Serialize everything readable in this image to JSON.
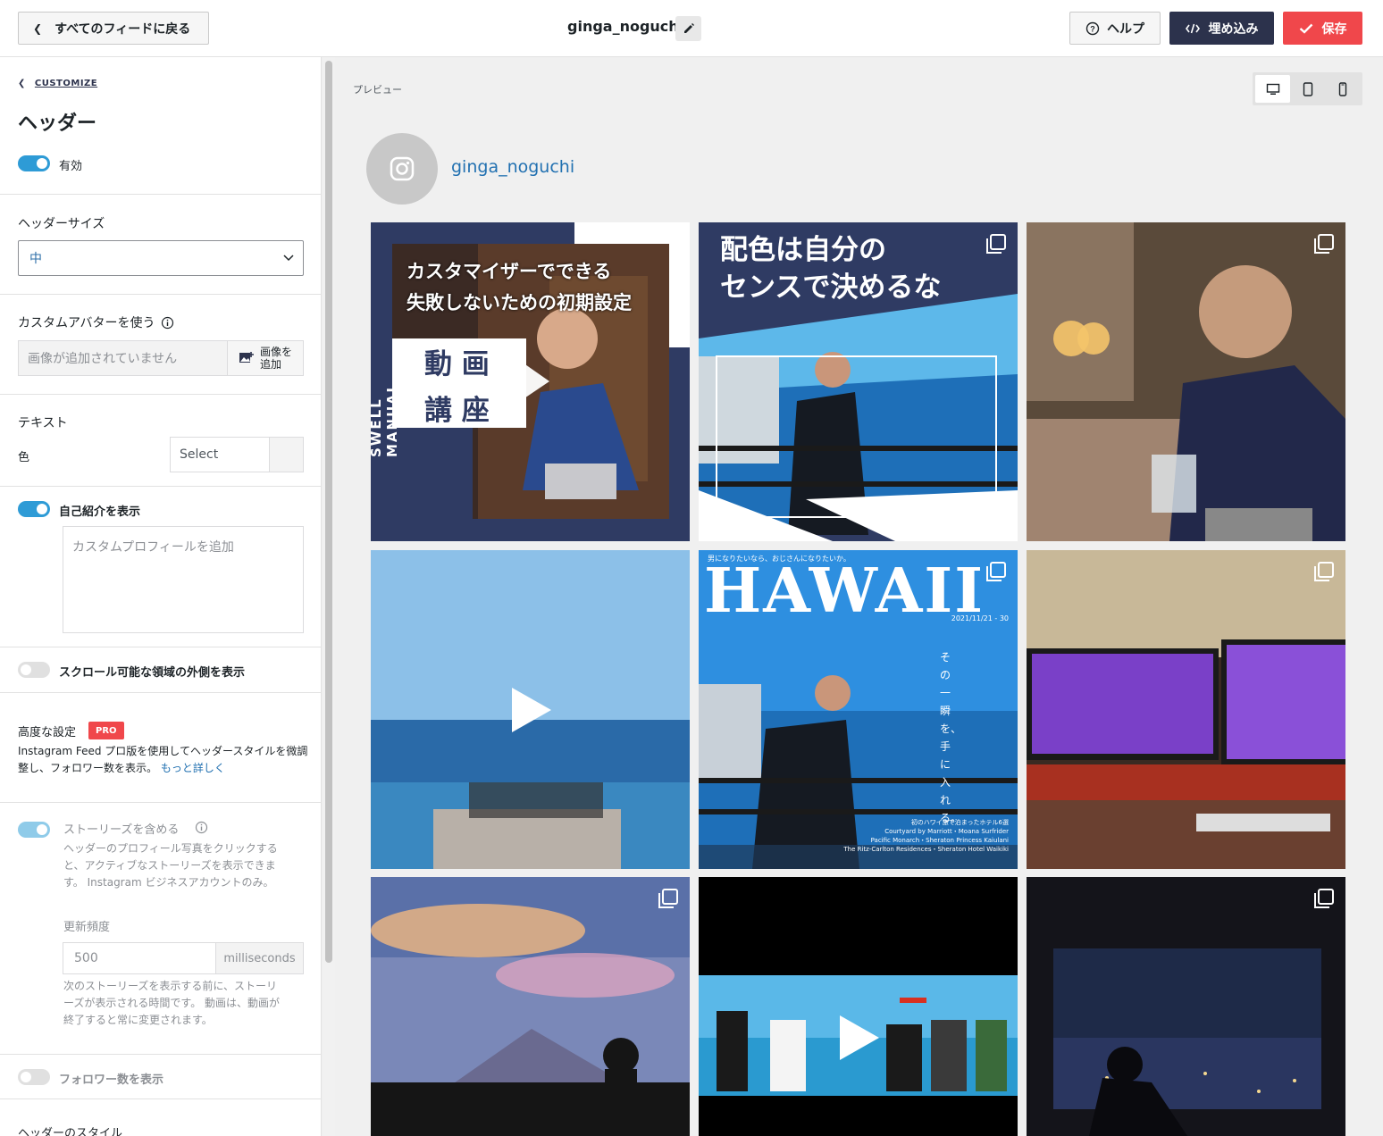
{
  "topbar": {
    "back_label": "すべてのフィードに戻る",
    "feed_name": "ginga_noguchi",
    "help_label": "ヘルプ",
    "embed_label": "埋め込み",
    "save_label": "保存"
  },
  "sidebar": {
    "breadcrumb": "CUSTOMIZE",
    "title": "ヘッダー",
    "enabled_label": "有効",
    "header_size_label": "ヘッダーサイズ",
    "header_size_value": "中",
    "custom_avatar_label": "カスタムアバターを使う",
    "avatar_placeholder": "画像が追加されていません",
    "add_image_line1": "画像を",
    "add_image_line2": "追加",
    "text_section": "テキスト",
    "color_label": "色",
    "color_select": "Select",
    "show_bio_label": "自己紹介を表示",
    "bio_placeholder": "カスタムプロフィールを追加",
    "show_outside_label": "スクロール可能な領域の外側を表示",
    "advanced_label": "高度な設定",
    "pro_badge": "PRO",
    "advanced_desc_1": "Instagram Feed プロ版を使用してヘッダースタイルを微調",
    "advanced_desc_2": "整し、フォロワー数を表示。",
    "learn_more": "もっと詳しく",
    "stories_label": "ストーリーズを含める",
    "stories_desc_1": "ヘッダーのプロフィール写真をクリックする",
    "stories_desc_2": "と、アクティブなストーリーズを表示できま",
    "stories_desc_3": "す。 Instagram ビジネスアカウントのみ。",
    "refresh_label": "更新頻度",
    "refresh_placeholder": "500",
    "refresh_unit": "milliseconds",
    "refresh_desc_1": "次のストーリーズを表示する前に、ストーリ",
    "refresh_desc_2": "ーズが表示される時間です。 動画は、動画が",
    "refresh_desc_3": "終了すると常に変更されます。",
    "followers_label": "フォロワー数を表示",
    "header_style_label": "ヘッダーのスタイル"
  },
  "preview": {
    "label": "プレビュー",
    "username": "ginga_noguchi",
    "tile1_vertical": "SWELL MANUAL",
    "tile1_line1": "カスタマイザーでできる",
    "tile1_line2": "失敗しないための初期設定",
    "tile1_box1": "動 画",
    "tile1_box2": "講 座",
    "tile2_line1": "配色は自分の",
    "tile2_line2": "センスで決めるな",
    "tile5_top": "男になりたいなら、おじさんになりたいか。",
    "tile5_title": "HAWAII",
    "tile5_date": "2021/11/21 - 30",
    "tile5_vertical": "その一瞬を、手に入れる。",
    "tile5_caption1": "初のハワイ旅で泊まったホテル6選",
    "tile5_caption2": "Courtyard by Marriott・Moana Surfrider",
    "tile5_caption3": "Pacific Monarch・Sheraton Princess Kaiulani",
    "tile5_caption4": "The Ritz-Carlton Residences・Sheraton Hotel Waikiki"
  },
  "colors": {
    "accent": "#2e9bd6",
    "navy": "#2c324c",
    "save": "#f0474b",
    "link": "#2271b1"
  }
}
